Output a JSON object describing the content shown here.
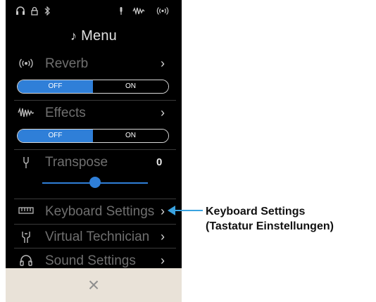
{
  "status_bar": {
    "icons": [
      "headphones-icon",
      "lock-icon",
      "bluetooth-icon",
      "microphone-icon",
      "effects-icon",
      "reverb-icon"
    ]
  },
  "menu": {
    "title": "Menu",
    "title_icon": "music-note-icon"
  },
  "rows": {
    "reverb": {
      "label": "Reverb",
      "icon": "reverb-icon"
    },
    "effects": {
      "label": "Effects",
      "icon": "effects-icon"
    },
    "transpose": {
      "label": "Transpose",
      "icon": "tuning-fork-icon",
      "value": "0",
      "slider_position": 0.5
    },
    "keyboard_settings": {
      "label": "Keyboard Settings",
      "icon": "keyboard-icon"
    },
    "virtual_technician": {
      "label": "Virtual Technician",
      "icon": "technician-icon"
    },
    "sound_settings": {
      "label": "Sound Settings",
      "icon": "headphones-icon"
    }
  },
  "toggles": {
    "reverb": {
      "off_label": "OFF",
      "on_label": "ON",
      "selected": "OFF"
    },
    "effects": {
      "off_label": "OFF",
      "on_label": "ON",
      "selected": "OFF"
    }
  },
  "close": {
    "icon": "close-icon",
    "glyph": "×"
  },
  "callout": {
    "line1": "Keyboard Settings",
    "line2": "(Tastatur Einstellungen)"
  },
  "colors": {
    "accent": "#2f7fd8",
    "callout_arrow": "#3aa3e0",
    "close_bar": "#e9e2d8",
    "background": "#000000"
  }
}
